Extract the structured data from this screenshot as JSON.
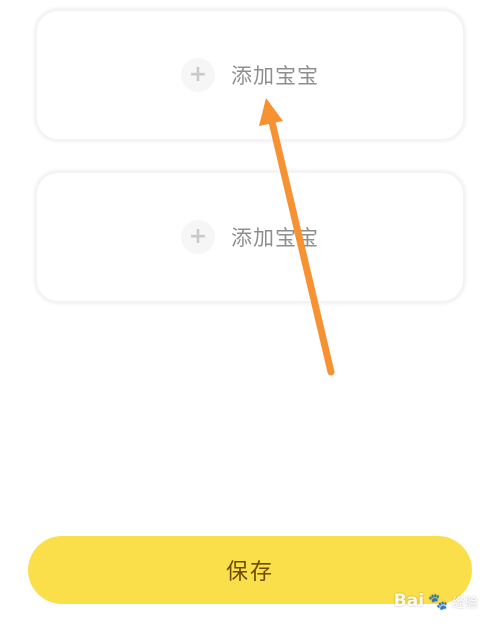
{
  "cards": [
    {
      "label": "添加宝宝",
      "icon": "plus-icon"
    },
    {
      "label": "添加宝宝",
      "icon": "plus-icon"
    }
  ],
  "save_button": {
    "label": "保存"
  },
  "colors": {
    "save_background": "#fbdf4a",
    "save_text": "#6b4a00",
    "annotation_arrow": "#f79232",
    "card_label": "#8e8e8e"
  },
  "watermark": {
    "text": "Bai",
    "suffix": "经验"
  }
}
